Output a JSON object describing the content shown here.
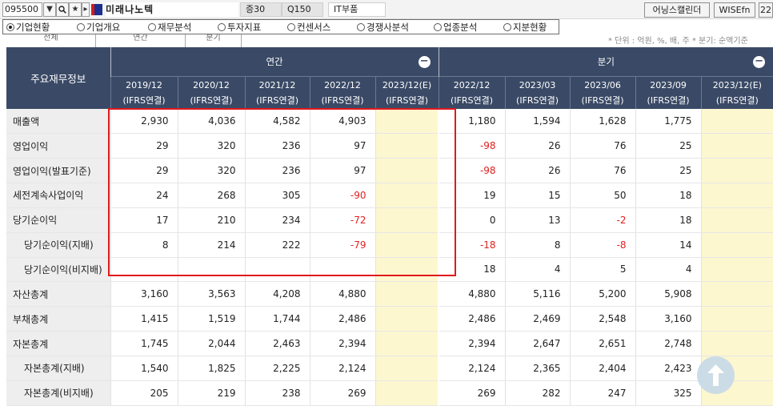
{
  "toolbar": {
    "stock_code": "095500",
    "stock_name": "미래나노텍",
    "tags": [
      "증30",
      "Q150",
      "IT부품"
    ],
    "right_buttons": [
      "어닝스캘린더",
      "WISEfn",
      "22"
    ],
    "dropdown_icon": "triangle-down",
    "search_icon": "magnifier",
    "favorite_icon": "star",
    "next_icon": "triangle-right"
  },
  "menu": {
    "items": [
      "기업현황",
      "기업개요",
      "재무분석",
      "투자지표",
      "컨센서스",
      "경쟁사분석",
      "업종분석",
      "지분현황"
    ],
    "selected": "기업현황"
  },
  "subtabs": [
    "전체",
    "연간",
    "분기"
  ],
  "unit_note": "* 단위 : 억원, %, 배, 주    * 분기: 순액기준",
  "table": {
    "corner_label": "주요재무정보",
    "annual_group": "연간",
    "quarter_group": "분기",
    "collapse_symbol": "−",
    "annual_cols": [
      {
        "period": "2019/12",
        "basis": "(IFRS연결)"
      },
      {
        "period": "2020/12",
        "basis": "(IFRS연결)"
      },
      {
        "period": "2021/12",
        "basis": "(IFRS연결)"
      },
      {
        "period": "2022/12",
        "basis": "(IFRS연결)"
      },
      {
        "period": "2023/12(E)",
        "basis": "(IFRS연결)"
      }
    ],
    "quarter_cols": [
      {
        "period": "2022/12",
        "basis": "(IFRS연결)"
      },
      {
        "period": "2023/03",
        "basis": "(IFRS연결)"
      },
      {
        "period": "2023/06",
        "basis": "(IFRS연결)"
      },
      {
        "period": "2023/09",
        "basis": "(IFRS연결)"
      },
      {
        "period": "2023/12(E)",
        "basis": "(IFRS연결)"
      }
    ],
    "rows": [
      {
        "label": "매출액",
        "indent": false,
        "annual": [
          "2,930",
          "4,036",
          "4,582",
          "4,903",
          ""
        ],
        "quarter": [
          "1,180",
          "1,594",
          "1,628",
          "1,775",
          ""
        ]
      },
      {
        "label": "영업이익",
        "indent": false,
        "annual": [
          "29",
          "320",
          "236",
          "97",
          ""
        ],
        "quarter": [
          "-98",
          "26",
          "76",
          "25",
          ""
        ]
      },
      {
        "label": "영업이익(발표기준)",
        "indent": false,
        "annual": [
          "29",
          "320",
          "236",
          "97",
          ""
        ],
        "quarter": [
          "-98",
          "26",
          "76",
          "25",
          ""
        ]
      },
      {
        "label": "세전계속사업이익",
        "indent": false,
        "annual": [
          "24",
          "268",
          "305",
          "-90",
          ""
        ],
        "quarter": [
          "19",
          "15",
          "50",
          "18",
          ""
        ]
      },
      {
        "label": "당기순이익",
        "indent": false,
        "annual": [
          "17",
          "210",
          "234",
          "-72",
          ""
        ],
        "quarter": [
          "0",
          "13",
          "-2",
          "18",
          ""
        ]
      },
      {
        "label": "당기순이익(지배)",
        "indent": true,
        "annual": [
          "8",
          "214",
          "222",
          "-79",
          ""
        ],
        "quarter": [
          "-18",
          "8",
          "-8",
          "14",
          ""
        ]
      },
      {
        "label": "당기순이익(비지배)",
        "indent": true,
        "annual": [
          "",
          "",
          "",
          "",
          ""
        ],
        "quarter": [
          "18",
          "4",
          "5",
          "4",
          ""
        ]
      },
      {
        "label": "자산총계",
        "indent": false,
        "annual": [
          "3,160",
          "3,563",
          "4,208",
          "4,880",
          ""
        ],
        "quarter": [
          "4,880",
          "5,116",
          "5,200",
          "5,908",
          ""
        ]
      },
      {
        "label": "부채총계",
        "indent": false,
        "annual": [
          "1,415",
          "1,519",
          "1,744",
          "2,486",
          ""
        ],
        "quarter": [
          "2,486",
          "2,469",
          "2,548",
          "3,160",
          ""
        ]
      },
      {
        "label": "자본총계",
        "indent": false,
        "annual": [
          "1,745",
          "2,044",
          "2,463",
          "2,394",
          ""
        ],
        "quarter": [
          "2,394",
          "2,647",
          "2,651",
          "2,748",
          ""
        ]
      },
      {
        "label": "자본총계(지배)",
        "indent": true,
        "annual": [
          "1,540",
          "1,825",
          "2,225",
          "2,124",
          ""
        ],
        "quarter": [
          "2,124",
          "2,365",
          "2,404",
          "2,423",
          ""
        ]
      },
      {
        "label": "자본총계(비지배)",
        "indent": true,
        "annual": [
          "205",
          "219",
          "238",
          "269",
          ""
        ],
        "quarter": [
          "269",
          "282",
          "247",
          "325",
          ""
        ]
      }
    ]
  },
  "colors": {
    "header_bg": "#3a4a66",
    "estimate_bg": "#fdf7cf",
    "negative": "#e02020",
    "highlight_box": "#e0191d"
  },
  "scroll_top_icon": "arrow-up"
}
